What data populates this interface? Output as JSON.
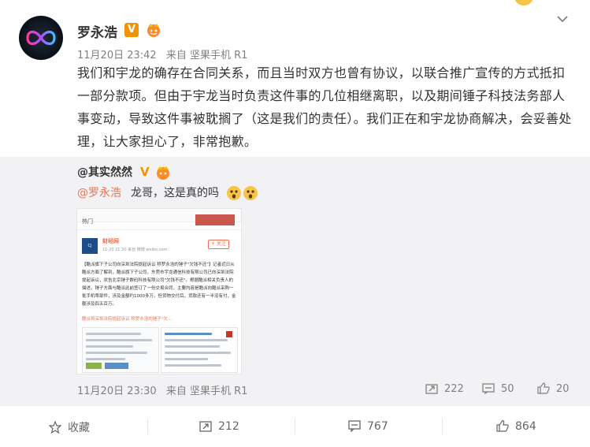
{
  "post": {
    "author": "罗永浩",
    "verified_badge": "V",
    "timestamp": "11月20日 23:42",
    "source_prefix": "来自",
    "source": "坚果手机 R1",
    "content": "我们和宇龙的确存在合同关系，而且当时双方也曾有协议，以联合推广宣传的方式抵扣一部分款项。但由于宇龙当时负责这件事的几位相继离职，以及期间锤子科技法务部人事变动，导致这件事被耽搁了（这是我们的责任）。我们正在和宇龙协商解决，会妥善处理，让大家担心了，非常抱歉。"
  },
  "repost": {
    "author": "@其实然然",
    "verified_badge": "V",
    "mention": "@罗永浩",
    "text": "龙哥，这是真的吗",
    "timestamp": "11月20日 23:30",
    "source_prefix": "来自",
    "source": "坚果手机 R1",
    "forward_count": "222",
    "comment_count": "50",
    "like_count": "20",
    "image": {
      "tab": "热门",
      "account": "财经网",
      "account_time": "11-20 21:30 来自 微博 weibo.com",
      "follow": "+ 关注",
      "body": "【酷派旗下子公司向深圳法院提起诉讼 称罗永浩的锤子\"欠钱不还\"】记者近日从酷派方面了解到，酷派旗下子公司，东莞市宇龙通信科技有限公司已向深圳法院提起诉讼，状告北京锤子数码科技有限公司\"欠钱不还\"。根据酷派相关负责人的描述，锤子方面与酷派此前签订了一份交易合同，主要内容是酷派向酷派采购一批手机零部件，涉及金额约1000多万。但货物交付后，货款还有一半没有付，金额涉及四五百万。",
      "link": "酷派将深圳法院提起诉讼 称罗永浩的锤子\"欠..."
    }
  },
  "toolbar": {
    "favorite": "收藏",
    "forward": "212",
    "comment": "767",
    "like": "864"
  },
  "colors": {
    "accent": "#eb7350",
    "badge": "#f29300",
    "repost_bg": "#f2f2f5",
    "meta": "#808080"
  }
}
